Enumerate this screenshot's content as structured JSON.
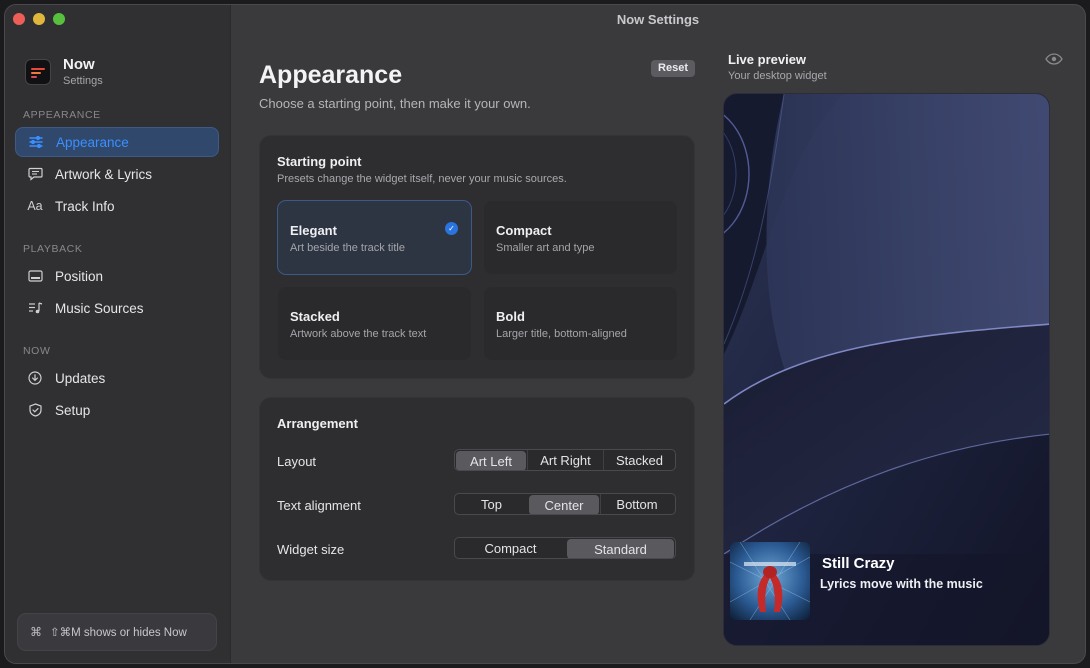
{
  "window": {
    "title": "Now Settings"
  },
  "app": {
    "name": "Now",
    "subtitle": "Settings"
  },
  "sidebar": {
    "sections": [
      {
        "label": "APPEARANCE",
        "items": [
          {
            "label": "Appearance",
            "icon": "sliders-icon",
            "active": true
          },
          {
            "label": "Artwork & Lyrics",
            "icon": "speech-bubble-icon",
            "active": false
          },
          {
            "label": "Track Info",
            "icon": "text-aa-icon",
            "active": false
          }
        ]
      },
      {
        "label": "PLAYBACK",
        "items": [
          {
            "label": "Position",
            "icon": "screen-position-icon",
            "active": false
          },
          {
            "label": "Music Sources",
            "icon": "music-list-icon",
            "active": false
          }
        ]
      },
      {
        "label": "NOW",
        "items": [
          {
            "label": "Updates",
            "icon": "download-circle-icon",
            "active": false
          },
          {
            "label": "Setup",
            "icon": "shield-check-icon",
            "active": false
          }
        ]
      }
    ],
    "shortcut": {
      "key_glyph": "⌘",
      "text": "⇧⌘M shows or hides Now"
    }
  },
  "main": {
    "title": "Appearance",
    "subtitle": "Choose a starting point, then make it your own.",
    "reset_label": "Reset",
    "starting_point": {
      "title": "Starting point",
      "subtitle": "Presets change the widget itself, never your music sources.",
      "presets": [
        {
          "name": "Elegant",
          "desc": "Art beside the track title",
          "selected": true
        },
        {
          "name": "Compact",
          "desc": "Smaller art and type",
          "selected": false
        },
        {
          "name": "Stacked",
          "desc": "Artwork above the track text",
          "selected": false
        },
        {
          "name": "Bold",
          "desc": "Larger title, bottom-aligned",
          "selected": false
        }
      ]
    },
    "arrangement": {
      "title": "Arrangement",
      "rows": [
        {
          "label": "Layout",
          "options": [
            "Art Left",
            "Art Right",
            "Stacked"
          ],
          "selected": "Art Left"
        },
        {
          "label": "Text alignment",
          "options": [
            "Top",
            "Center",
            "Bottom"
          ],
          "selected": "Center"
        },
        {
          "label": "Widget size",
          "options": [
            "Compact",
            "Standard"
          ],
          "selected": "Standard"
        }
      ]
    }
  },
  "preview": {
    "title": "Live preview",
    "subtitle": "Your desktop widget",
    "icon": "eye-icon",
    "track_title": "Still Crazy",
    "lyric": "Lyrics move with the music"
  },
  "colors": {
    "accent": "#3b8fff",
    "active_bg": "#30486c",
    "window_bg": "#3a3a3d",
    "sidebar_bg": "#303033",
    "card_bg": "#2e2e31"
  }
}
